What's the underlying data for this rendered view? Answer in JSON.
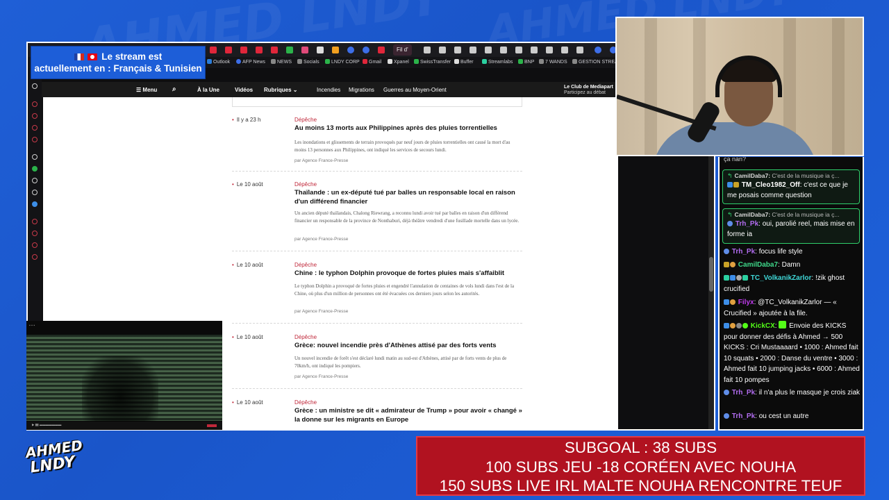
{
  "background": {
    "brand_text": "AHMED LNDY",
    "color": "#1f5fd6"
  },
  "language_banner": {
    "line1": "Le stream est",
    "line2": "actuellement en : Français & Tunisien",
    "flags": [
      "france-flag",
      "tunisia-flag"
    ]
  },
  "browser": {
    "active_tab_label": "Fil d'",
    "bookmarks": [
      "Outlook",
      "AFP News",
      "NEWS",
      "Socials",
      "LNDY CORP",
      "Gmail",
      "Xpanel",
      "SwissTransfer",
      "Buffer",
      "Streamlabs",
      "BNP",
      "7 WANDS",
      "GESTION STREAM"
    ],
    "site_nav": {
      "menu": "Menu",
      "items": [
        "À la Une",
        "Vidéos",
        "Rubriques"
      ],
      "topics": [
        "Incendies",
        "Migrations",
        "Guerres au Moyen-Orient"
      ],
      "club_title": "Le Club de Mediapart",
      "club_sub": "Participez au débat"
    },
    "articles": [
      {
        "date": "Il y a 23 h",
        "category": "Dépêche",
        "title": "Au moins 13 morts aux Philippines après des pluies torrentielles",
        "desc": "Les inondations et glissements de terrain provoqués par neuf jours de pluies torrentielles ont causé la mort d'au moins 13 personnes aux Philippines, ont indiqué les services de secours lundi.",
        "byline": "par Agence France-Presse"
      },
      {
        "date": "Le 10 août",
        "category": "Dépêche",
        "title": "Thaïlande : un ex-député tué par balles un responsable local en raison d'un différend financier",
        "desc": "Un ancien député thaïlandais, Chalong Riewrang, a reconnu lundi avoir tué par balles en raison d'un différend financier un responsable de la province de Nonthaburi, déjà théâtre vendredi d'une fusillade mortelle dans un lycée.",
        "byline": "par Agence France-Presse"
      },
      {
        "date": "Le 10 août",
        "category": "Dépêche",
        "title": "Chine : le typhon Dolphin provoque de fortes pluies mais s'affaiblit",
        "desc": "Le typhon Dolphin a provoqué de fortes pluies et engendré l'annulation de centaines de vols lundi dans l'est de la Chine, où plus d'un million de personnes ont été évacuées ces derniers jours selon les autorités.",
        "byline": "par Agence France-Presse"
      },
      {
        "date": "Le 10 août",
        "category": "Dépêche",
        "title": "Grèce: nouvel incendie près d'Athènes attisé par des forts vents",
        "desc": "Un nouvel incendie de forêt s'est déclaré lundi matin au sud-est d'Athènes, attisé par de forts vents de plus de 70km/h, ont indiqué les pompiers.",
        "byline": "par Agence France-Presse"
      },
      {
        "date": "Le 10 août",
        "category": "Dépêche",
        "title": "Grèce : un ministre se dit « admirateur de Trump » pour avoir « changé » la donne sur les migrants en Europe",
        "desc": "",
        "byline": ""
      }
    ]
  },
  "chat": {
    "top_fragment": "ça nan?",
    "replies": [
      {
        "reply_to": "CamilDaba7:",
        "reply_text": "C'est de la musique ia ç...",
        "user": "TM_Cleo1982_Off",
        "user_color": "#ffffff",
        "text": "c'est ce que je me posais comme question"
      },
      {
        "reply_to": "CamilDaba7:",
        "reply_text": "C'est de la musique ia ç...",
        "user": "Trh_Pk",
        "user_color": "#b26cf0",
        "text": "oui, parolié reel, mais mise en forme ia"
      }
    ],
    "messages": [
      {
        "user": "Trh_Pk",
        "color": "#b26cf0",
        "text": "focus life style"
      },
      {
        "user": "CamilDaba7",
        "color": "#3fd88a",
        "text": "Damn"
      },
      {
        "user": "TC_VolkanikZarlor",
        "color": "#3fd8d8",
        "text": "!zik ghost crucified"
      },
      {
        "user": "Filyx",
        "color": "#c23cf0",
        "text": "@TC_VolkanikZarlor — « Crucified » ajoutée à la file."
      },
      {
        "user": "KickCX",
        "color": "#53fc18",
        "text": "Envoie des KICKS pour donner des défis à Ahmed → 500 KICKS : Cri Mustaaaard • 1000 : Ahmed fait 10 squats • 2000 : Danse du ventre • 3000 : Ahmed fait 10 jumping jacks • 6000 : Ahmed fait 10 pompes"
      },
      {
        "user": "Trh_Pk",
        "color": "#b26cf0",
        "text": "il n'a plus le masque je crois ziak"
      },
      {
        "user": "Trh_Pk",
        "color": "#b26cf0",
        "text": "ou cest un autre"
      }
    ]
  },
  "subgoal": {
    "line1": "SUBGOAL : 38 SUBS",
    "line2": "100 SUBS JEU -18 CORÉEN AVEC NOUHA",
    "line3": "150 SUBS LIVE IRL MALTE NOUHA RENCONTRE TEUF"
  },
  "logo": {
    "line1": "AHMED",
    "line2": "LNDY"
  }
}
